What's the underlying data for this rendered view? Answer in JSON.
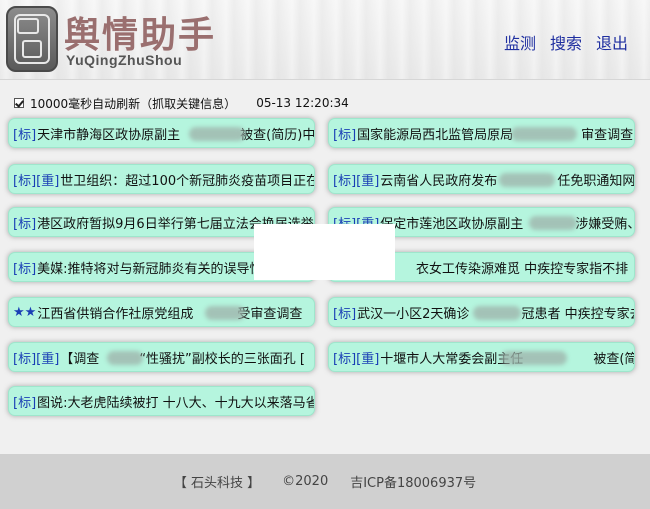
{
  "header": {
    "title": "舆情助手",
    "subtitle": "YuQingZhuShou",
    "nav": [
      {
        "label": "监测"
      },
      {
        "label": "搜索"
      },
      {
        "label": "退出"
      }
    ]
  },
  "refresh": {
    "checked": true,
    "label": "10000毫秒自动刷新（抓取关键信息）",
    "time": "05-13 12:20:34"
  },
  "news": [
    {
      "tags": "[标]",
      "text": "天津市静海区政协原副主",
      "text2": "被查(简历)中国"
    },
    {
      "tags": "[标]",
      "text": "国家能源局西北监管局原局",
      "text2": "审查调查"
    },
    {
      "tags": "[标][重]",
      "text": "世卫组织：超过100个新冠肺炎疫苗项目正在",
      "text2": ""
    },
    {
      "tags": "[标][重]",
      "text": "云南省人民政府发布",
      "text2": "任免职通知网"
    },
    {
      "tags": "[标]",
      "text": "港区政府暂拟9月6日举行第七届立法会换届选举",
      "text2": ""
    },
    {
      "tags": "[标][重]",
      "text": "保定市莲池区政协原副主",
      "text2": "涉嫌受贿、"
    },
    {
      "tags": "[标]",
      "text": "美媒:推特将对与新冠肺炎有关的误导性",
      "text2": ""
    },
    {
      "tags": "",
      "text": "",
      "text2": "衣女工传染源难觅 中疾控专家指不排"
    },
    {
      "tags": "★★",
      "text": "江西省供销合作社原党组成",
      "text2": "受审查调查"
    },
    {
      "tags": "[标]",
      "text": "武汉一小区2天确诊",
      "text2": "冠患者 中疾控专家去洞"
    },
    {
      "tags": "[标][重]",
      "text": "【调查",
      "text2": "“性骚扰”副校长的三张面孔 ["
    },
    {
      "tags": "[标][重]",
      "text": "十堰市人大常委会副主任",
      "text2": "被查(简历)中国经"
    },
    {
      "tags": "[标]",
      "text": "图说:大老虎陆续被打 十八大、十九大以来落马省",
      "text2": ""
    }
  ],
  "footer": {
    "company": "【 石头科技 】",
    "copyright": "©2020",
    "icp": "吉ICP备18006937号"
  }
}
